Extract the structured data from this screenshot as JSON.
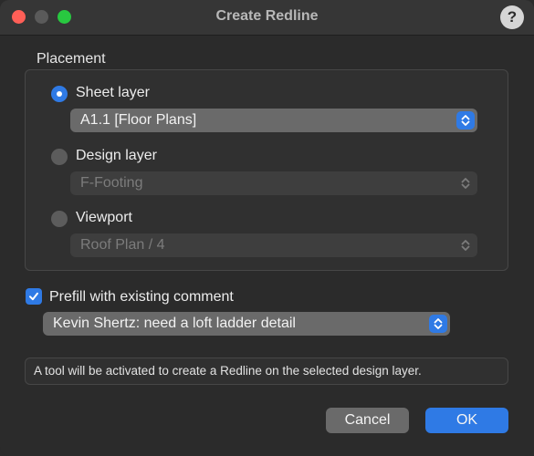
{
  "window": {
    "title": "Create Redline",
    "help_label": "?"
  },
  "placement": {
    "section_label": "Placement",
    "sheet_layer": {
      "label": "Sheet layer",
      "selected": true,
      "popup_value": "A1.1 [Floor Plans]",
      "enabled": true
    },
    "design_layer": {
      "label": "Design layer",
      "selected": false,
      "popup_value": "F-Footing",
      "enabled": false
    },
    "viewport": {
      "label": "Viewport",
      "selected": false,
      "popup_value": "Roof Plan / 4",
      "enabled": false
    }
  },
  "prefill": {
    "label": "Prefill with existing comment",
    "checked": true,
    "popup_value": "Kevin Shertz: need a loft ladder detail"
  },
  "info_text": "A tool will be activated to create a Redline on the selected design layer.",
  "buttons": {
    "cancel": "Cancel",
    "ok": "OK"
  },
  "colors": {
    "accent": "#2f7ae5",
    "close": "#ff5f57",
    "maximize": "#28c840"
  },
  "icons": {
    "stepper": "chevron-up-down-icon",
    "check": "checkmark-icon",
    "help": "question-mark-icon"
  }
}
